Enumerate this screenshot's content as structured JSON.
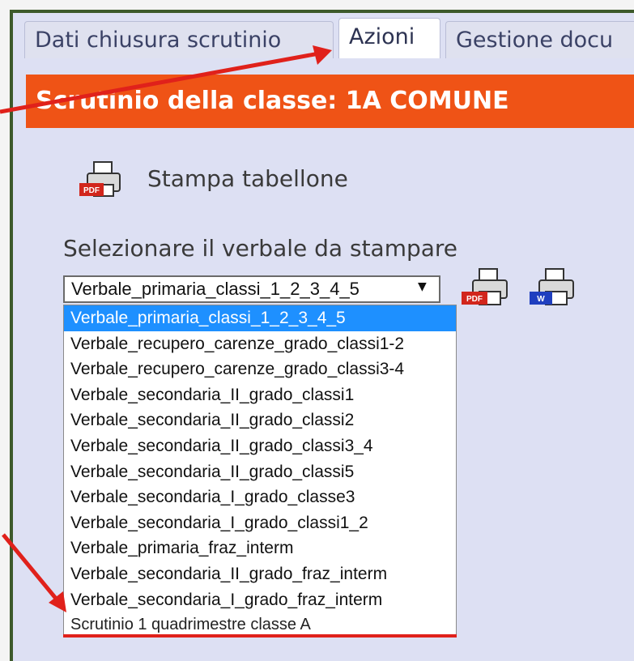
{
  "tabs": [
    {
      "label": "Dati chiusura scrutinio"
    },
    {
      "label": "Azioni"
    },
    {
      "label": "Gestione docu"
    }
  ],
  "header": {
    "title": "Scrutinio della classe: 1A COMUNE"
  },
  "print_board": {
    "label": "Stampa tabellone",
    "icon": "pdf-print-icon"
  },
  "verbale": {
    "title": "Selezionare il verbale da stampare",
    "selected": "Verbale_primaria_classi_1_2_3_4_5",
    "options": [
      "Verbale_primaria_classi_1_2_3_4_5",
      "Verbale_recupero_carenze_grado_classi1-2",
      "Verbale_recupero_carenze_grado_classi3-4",
      "Verbale_secondaria_II_grado_classi1",
      "Verbale_secondaria_II_grado_classi2",
      "Verbale_secondaria_II_grado_classi3_4",
      "Verbale_secondaria_II_grado_classi5",
      "Verbale_secondaria_I_grado_classe3",
      "Verbale_secondaria_I_grado_classi1_2",
      "Verbale_primaria_fraz_interm",
      "Verbale_secondaria_II_grado_fraz_interm",
      "Verbale_secondaria_I_grado_fraz_interm",
      "Scrutinio 1 quadrimestre classe A"
    ]
  },
  "icons": {
    "pdf_label": "PDF",
    "word_label": "W"
  },
  "colors": {
    "header_bg": "#ef5316",
    "selected_option": "#1e90ff",
    "annotation": "#e0211b",
    "frame": "#3d5a2b"
  }
}
